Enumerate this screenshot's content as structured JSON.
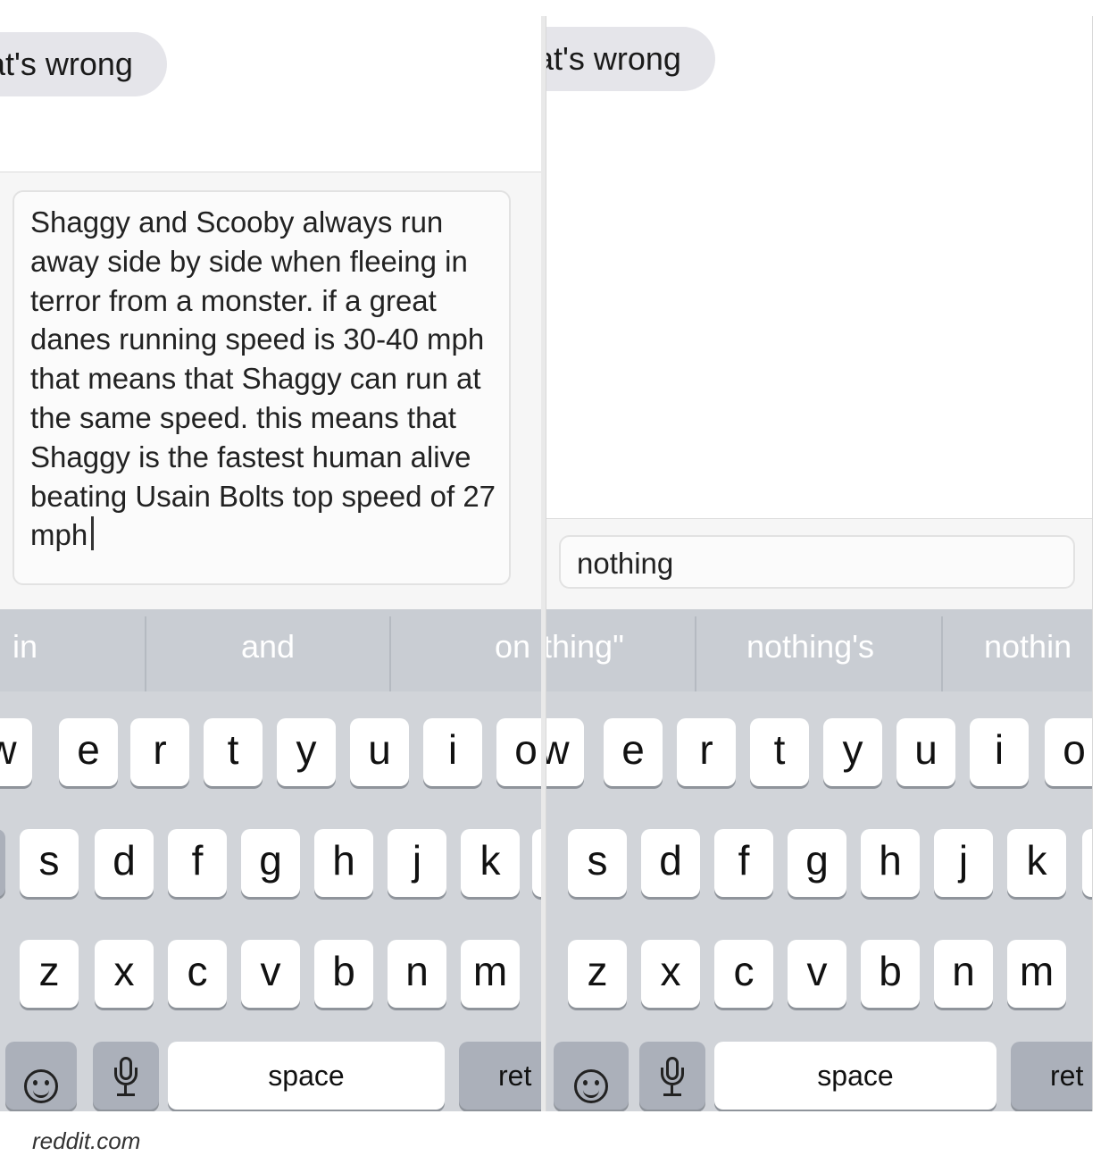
{
  "left_panel": {
    "message_bubble": "at's wrong",
    "compose_text": "Shaggy and Scooby always run away side by side when fleeing in terror from a monster. if a great danes running speed is 30-40 mph that means that Shaggy can run at the same speed. this means that Shaggy is the fastest human alive beating Usain Bolts top speed of 27 mph",
    "predictions": [
      "in",
      "and",
      "on"
    ],
    "keys_row1": [
      "w",
      "e",
      "r",
      "t",
      "y",
      "u",
      "i",
      "o"
    ],
    "keys_row2": [
      "s",
      "d",
      "f",
      "g",
      "h",
      "j",
      "k"
    ],
    "keys_row3": [
      "z",
      "x",
      "c",
      "v",
      "b",
      "n",
      "m"
    ],
    "space_label": "space",
    "return_label": "ret"
  },
  "right_panel": {
    "message_bubble": "at's wrong",
    "compose_text": "nothing",
    "predictions": [
      "thing\"",
      "nothing's",
      "nothin"
    ],
    "keys_row1": [
      "w",
      "e",
      "r",
      "t",
      "y",
      "u",
      "i",
      "o"
    ],
    "keys_row2": [
      "s",
      "d",
      "f",
      "g",
      "h",
      "j",
      "k"
    ],
    "keys_row3": [
      "z",
      "x",
      "c",
      "v",
      "b",
      "n",
      "m"
    ],
    "space_label": "space",
    "return_label": "ret"
  },
  "icons": {
    "emoji_key": "emoji-icon",
    "dictation_key": "microphone-icon"
  },
  "credit": "reddit.com",
  "colors": {
    "bubble": "#e5e5ea",
    "keyboard_bg": "#d1d4d9",
    "key": "#ffffff",
    "function_key": "#abb0ba",
    "prediction_text": "#ffffff"
  }
}
